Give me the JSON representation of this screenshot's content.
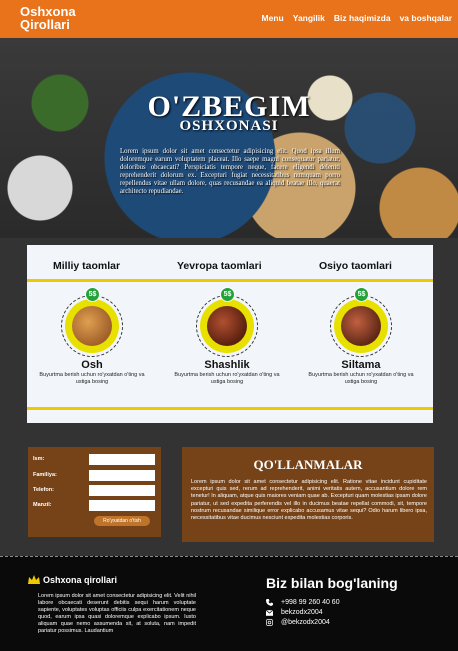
{
  "header": {
    "logo_line1": "Oshxona",
    "logo_line2": "Qirollari",
    "nav": [
      "Menu",
      "Yangilik",
      "Biz haqimizda",
      "va boshqalar"
    ]
  },
  "hero": {
    "title_line1": "O'ZBEGIM",
    "title_line2": "OSHXONASI",
    "text": "Lorem ipsum dolor sit amet consectetur adipisicing elit. Quod ipsa illum doloremque earum voluptatem placeat. Illo saepe magni consequatur pariatur, doloribus obcaecati? Perspiciatis tempore neque, facere eligendi deleniti reprehenderit dolorum ex. Excepturi fugiat necessitatibus numquam porro repellendus vitae ullam dolore, quas recusandae ea aliquid beatae illo, quaerat architecto repudiandae."
  },
  "menu": {
    "categories": [
      "Milliy taomlar",
      "Yevropa taomlari",
      "Osiyo taomlari"
    ],
    "items": [
      {
        "name": "Osh",
        "price": "5$",
        "desc": "Buyurtma berish uchun ro'yxatdan o'ting va ustiga bosing"
      },
      {
        "name": "Shashlik",
        "price": "5$",
        "desc": "Buyurtma berish uchun ro'yxatdan o'ting va ustiga bosing"
      },
      {
        "name": "Siltama",
        "price": "5$",
        "desc": "Buyurtma berish uchun ro'yxatdan o'ting va ustiga bosing"
      }
    ]
  },
  "form": {
    "labels": [
      "Ism:",
      "Familiya:",
      "Telefon:",
      "Manzil:"
    ],
    "submit": "Ro'yxatdan o'tish"
  },
  "guides": {
    "title": "QO'LLANMALAR",
    "text": "Lorem ipsum dolor sit amet consectetur adipisicing elit. Ratione vitae incidunt cupiditate excepturi quis sed, rerum ad reprehenderit, animi veritatis autem, accusantium dolore rem tenetur! In aliquam, atque quis maiores veniam quae ab. Excepturi quam molestias ipsam dolore pariatur, ut sed expedita perferendis vel illo in ducimus beatae repellat commodi, sit, tempore nostrum recusandae similique error explicabo accusamus vitae sequi? Odio harum libero ipsa, necessitatibus vitae ducimus nesciunt expedita molestias corporis."
  },
  "footer": {
    "brand": "Oshxona qirollari",
    "text": "Lorem ipsum dolor sit amet consectetur adipisicing elit. Velit nihil labore obcaecati deserunt debitis sequi harum voluptate sapiente, voluptates voluptas officiis culpa exercitationem neque quod, earum ipsa quasi doloremque explicabo ipsum. Iusto aliquam quae nemo assumenda sit, at soluta, nam impedit pariatur possimus. Laudantium",
    "contact_title": "Biz bilan bog'laning",
    "phone": "+998 99 260 40 60",
    "email": "bekzodx2004",
    "instagram": "@bekzodx2004"
  },
  "colors": {
    "header": "#e8731a",
    "accent_yellow": "#f0c800",
    "price_badge": "#23a23a",
    "box_brown": "#82461a"
  }
}
